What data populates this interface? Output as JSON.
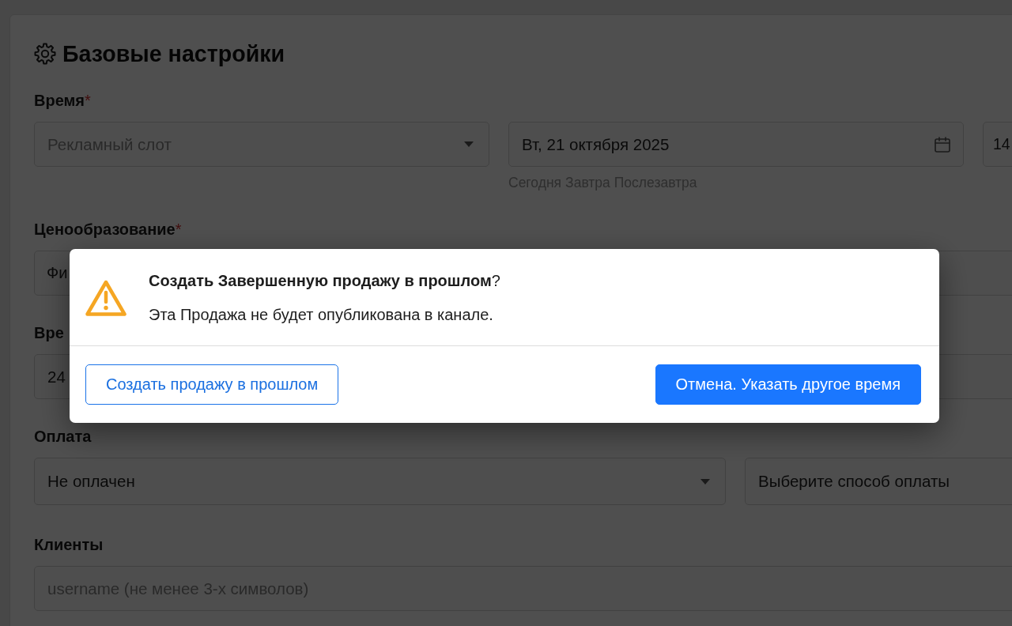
{
  "page": {
    "title": "Базовые настройки"
  },
  "sections": [
    {
      "label": "Время",
      "required_mark": "*",
      "fields": [
        {
          "kind": "select",
          "placeholder": "Рекламный слот"
        },
        {
          "kind": "date",
          "value": "Вт, 21 октября 2025",
          "shortcuts": [
            "Сегодня",
            "Завтра",
            "Послезавтра"
          ]
        },
        {
          "kind": "text",
          "value": "14"
        }
      ]
    },
    {
      "label": "Ценообразование",
      "required_mark": "*",
      "fields": [
        {
          "kind": "text",
          "value": "Фи"
        },
        {
          "kind": "text"
        }
      ]
    },
    {
      "label": "Вре",
      "fields": [
        {
          "kind": "text",
          "value": "24"
        },
        {
          "kind": "text"
        }
      ]
    },
    {
      "label": "Оплата",
      "fields": [
        {
          "kind": "select",
          "value": "Не оплачен"
        },
        {
          "kind": "text",
          "value": "Выберите способ оплаты"
        }
      ]
    },
    {
      "label": "Клиенты",
      "fields": [
        {
          "kind": "text",
          "placeholder": "username (не менее 3-х символов)"
        }
      ]
    }
  ],
  "dialog": {
    "title": "**Создать Завершенную продажу в прошлом**?",
    "message": "Эта Продажа не будет опубликована в канале.",
    "buttons": [
      {
        "label": "Создать продажу в прошлом",
        "kind": "secondary"
      },
      {
        "label": "Отмена. Указать другое время",
        "kind": "primary"
      }
    ]
  }
}
